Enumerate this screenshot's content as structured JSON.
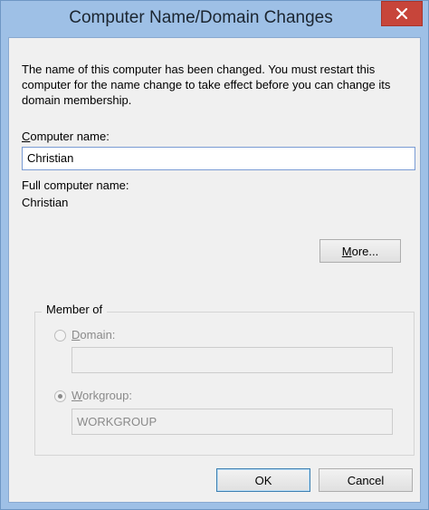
{
  "window": {
    "title": "Computer Name/Domain Changes"
  },
  "description": "The name of this computer has been changed.  You must restart this computer for the name change to take effect before you can change its domain membership.",
  "computer_name": {
    "label_accel": "C",
    "label_rest": "omputer name:",
    "value": "Christian"
  },
  "full_name": {
    "label": "Full computer name:",
    "value": "Christian"
  },
  "more_button": {
    "accel": "M",
    "rest": "ore..."
  },
  "member_of": {
    "legend": "Member of",
    "domain": {
      "accel": "D",
      "rest": "omain:",
      "selected": false,
      "value": ""
    },
    "workgroup": {
      "accel": "W",
      "rest": "orkgroup:",
      "selected": true,
      "value": "WORKGROUP"
    }
  },
  "buttons": {
    "ok": "OK",
    "cancel": "Cancel"
  },
  "icons": {
    "close": "close-icon"
  },
  "colors": {
    "titlebar": "#9ec0e6",
    "close_button": "#c7453a",
    "client": "#f0f0f0"
  }
}
